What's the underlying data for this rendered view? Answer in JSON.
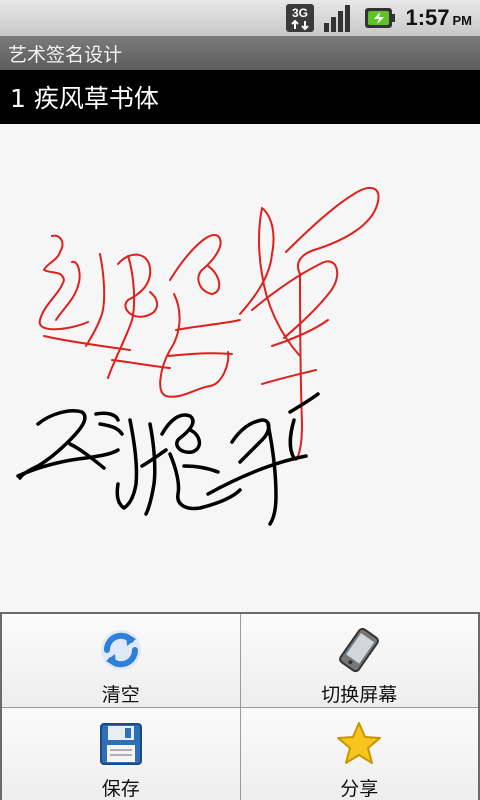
{
  "status_bar": {
    "network_label": "3G",
    "network_icon": "3g-data-icon",
    "signal_icon": "signal-strength-icon",
    "battery_icon": "battery-charging-icon",
    "time": "1:57",
    "ampm": "PM"
  },
  "app": {
    "title": "艺术签名设计"
  },
  "header": {
    "text": "1 疾风草书体"
  },
  "menu": {
    "items": [
      {
        "label": "清空",
        "icon": "refresh-icon"
      },
      {
        "label": "切换屏幕",
        "icon": "phone-rotate-icon"
      },
      {
        "label": "保存",
        "icon": "floppy-disk-icon"
      },
      {
        "label": "分享",
        "icon": "star-icon"
      }
    ]
  },
  "colors": {
    "signature_red": "#e0201c",
    "signature_black": "#000000",
    "canvas_bg": "#f6f6f6",
    "titlebar_bg": "#6a6a6a"
  }
}
